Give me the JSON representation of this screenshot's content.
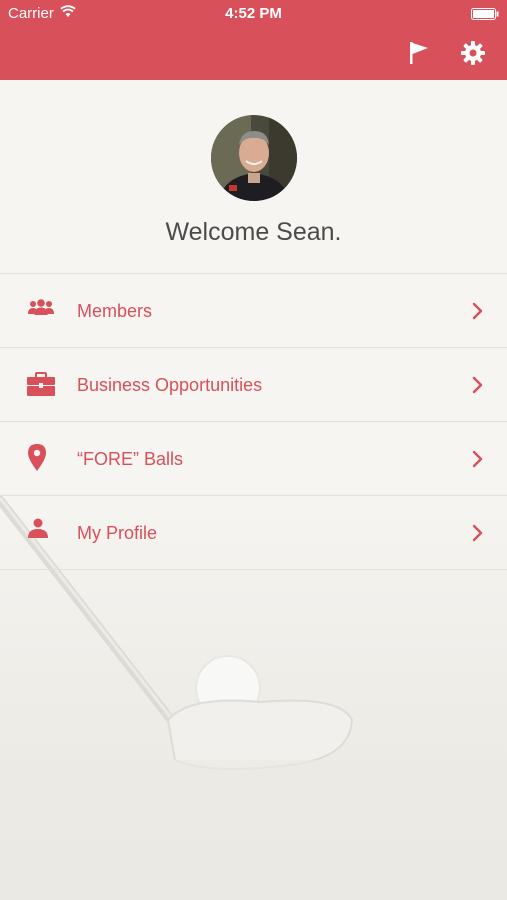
{
  "status_bar": {
    "carrier": "Carrier",
    "time": "4:52 PM"
  },
  "header": {
    "icons": [
      "flag-icon",
      "gear-icon"
    ]
  },
  "profile": {
    "welcome_text": "Welcome Sean."
  },
  "menu": {
    "items": [
      {
        "label": "Members",
        "icon": "members-icon"
      },
      {
        "label": "Business Opportunities",
        "icon": "briefcase-icon"
      },
      {
        "label": "“FORE” Balls",
        "icon": "location-pin-icon"
      },
      {
        "label": "My Profile",
        "icon": "person-icon"
      }
    ]
  },
  "colors": {
    "accent": "#d8505a",
    "background": "#f6f5f1",
    "text": "#4b4b4b"
  }
}
